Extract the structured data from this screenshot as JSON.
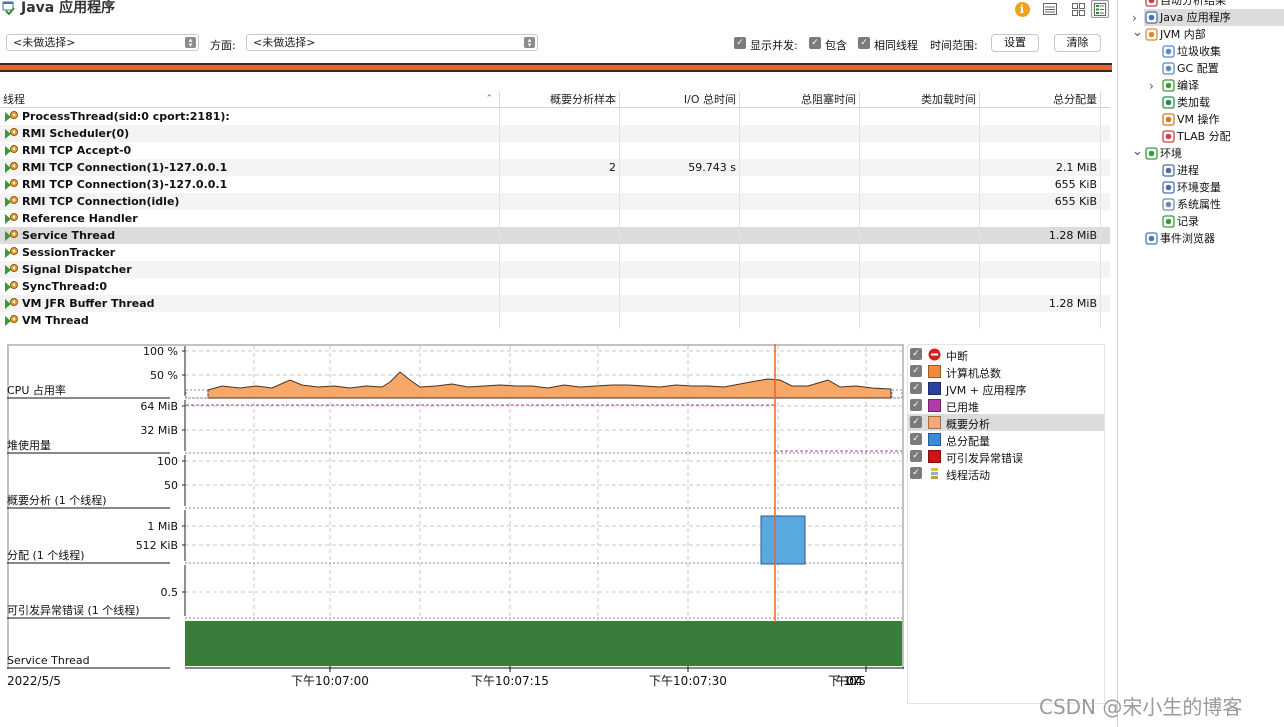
{
  "window": {
    "title": "Java 应用程序"
  },
  "toolbar": {
    "info_icon": "info-icon",
    "list_icon": "list-view-icon",
    "grid_icon": "grid-view-icon",
    "detail_icon": "detail-view-icon"
  },
  "filter": {
    "thread_select": "<未做选择>",
    "aspect_label": "方面:",
    "aspect_select": "<未做选择>",
    "show_concurrent": "显示并发:",
    "include": "包含",
    "same_thread": "相同线程",
    "time_range": "时间范围:",
    "settings": "设置",
    "clear": "清除"
  },
  "table": {
    "columns": [
      "线程",
      "概要分析样本",
      "I/O 总时间",
      "总阻塞时间",
      "类加载时间",
      "总分配量"
    ],
    "rows": [
      {
        "name": "ProcessThread(sid:0 cport:2181):",
        "samples": "",
        "io": "",
        "blocked": "",
        "classload": "",
        "alloc": ""
      },
      {
        "name": "RMI Scheduler(0)",
        "samples": "",
        "io": "",
        "blocked": "",
        "classload": "",
        "alloc": ""
      },
      {
        "name": "RMI TCP Accept-0",
        "samples": "",
        "io": "",
        "blocked": "",
        "classload": "",
        "alloc": ""
      },
      {
        "name": "RMI TCP Connection(1)-127.0.0.1",
        "samples": "2",
        "io": "59.743 s",
        "blocked": "",
        "classload": "",
        "alloc": "2.1 MiB"
      },
      {
        "name": "RMI TCP Connection(3)-127.0.0.1",
        "samples": "",
        "io": "",
        "blocked": "",
        "classload": "",
        "alloc": "655 KiB"
      },
      {
        "name": "RMI TCP Connection(idle)",
        "samples": "",
        "io": "",
        "blocked": "",
        "classload": "",
        "alloc": "655 KiB"
      },
      {
        "name": "Reference Handler",
        "samples": "",
        "io": "",
        "blocked": "",
        "classload": "",
        "alloc": ""
      },
      {
        "name": "Service Thread",
        "samples": "",
        "io": "",
        "blocked": "",
        "classload": "",
        "alloc": "1.28 MiB"
      },
      {
        "name": "SessionTracker",
        "samples": "",
        "io": "",
        "blocked": "",
        "classload": "",
        "alloc": ""
      },
      {
        "name": "Signal Dispatcher",
        "samples": "",
        "io": "",
        "blocked": "",
        "classload": "",
        "alloc": ""
      },
      {
        "name": "SyncThread:0",
        "samples": "",
        "io": "",
        "blocked": "",
        "classload": "",
        "alloc": ""
      },
      {
        "name": "VM JFR Buffer Thread",
        "samples": "",
        "io": "",
        "blocked": "",
        "classload": "",
        "alloc": "1.28 MiB"
      },
      {
        "name": "VM Thread",
        "samples": "",
        "io": "",
        "blocked": "",
        "classload": "",
        "alloc": ""
      }
    ]
  },
  "charts": {
    "lanes": [
      {
        "label": "CPU 占用率",
        "ticks": [
          "100 %",
          "50 %"
        ]
      },
      {
        "label": "堆使用量",
        "ticks": [
          "64 MiB",
          "32 MiB"
        ]
      },
      {
        "label": "概要分析 (1 个线程)",
        "ticks": [
          "100",
          "50"
        ]
      },
      {
        "label": "分配 (1 个线程)",
        "ticks": [
          "1 MiB",
          "512 KiB"
        ]
      },
      {
        "label": "可引发异常错误 (1 个线程)",
        "ticks": [
          "0.5"
        ]
      },
      {
        "label": "Service Thread",
        "ticks": []
      }
    ],
    "date": "2022/5/5",
    "time_ticks": [
      "下午10:07:00",
      "下午10:07:15",
      "下午10:07:30",
      "下午10:07:45"
    ],
    "colors": {
      "cpu_fill": "#f5a868",
      "heap_line": "#b03aa8",
      "alloc_bar": "#5aa8e0",
      "thread_bar": "#3a7d3a",
      "marker": "#e8662a"
    }
  },
  "legend": [
    {
      "label": "中断",
      "icon": "stop-icon",
      "color": "#d62020"
    },
    {
      "label": "计算机总数",
      "icon": "swatch",
      "color": "#f08a3c"
    },
    {
      "label": "JVM + 应用程序",
      "icon": "swatch",
      "color": "#2b3fa0"
    },
    {
      "label": "已用堆",
      "icon": "swatch",
      "color": "#b03aa8"
    },
    {
      "label": "概要分析",
      "icon": "swatch",
      "color": "#f5a878"
    },
    {
      "label": "总分配量",
      "icon": "swatch",
      "color": "#3a8ad8"
    },
    {
      "label": "可引发异常错误",
      "icon": "swatch",
      "color": "#cc1414"
    },
    {
      "label": "线程活动",
      "icon": "thread-activity-icon",
      "color": "#e0c040"
    }
  ],
  "nav": {
    "items": [
      {
        "label": "自动分析结果",
        "icon": "analysis-icon"
      },
      {
        "label": "Java 应用程序",
        "icon": "java-app-icon"
      },
      {
        "label": "JVM 内部",
        "icon": "jvm-icon"
      },
      {
        "label": "垃圾收集",
        "icon": "trash-icon"
      },
      {
        "label": "GC 配置",
        "icon": "gc-config-icon"
      },
      {
        "label": "编译",
        "icon": "compile-icon"
      },
      {
        "label": "类加载",
        "icon": "class-load-icon"
      },
      {
        "label": "VM 操作",
        "icon": "vm-ops-icon"
      },
      {
        "label": "TLAB 分配",
        "icon": "tlab-icon"
      },
      {
        "label": "环境",
        "icon": "environment-icon"
      },
      {
        "label": "进程",
        "icon": "process-icon"
      },
      {
        "label": "环境变量",
        "icon": "env-vars-icon"
      },
      {
        "label": "系统属性",
        "icon": "system-props-icon"
      },
      {
        "label": "记录",
        "icon": "record-icon"
      },
      {
        "label": "事件浏览器",
        "icon": "event-browser-icon"
      }
    ]
  },
  "watermark": "CSDN @宋小生的博客"
}
